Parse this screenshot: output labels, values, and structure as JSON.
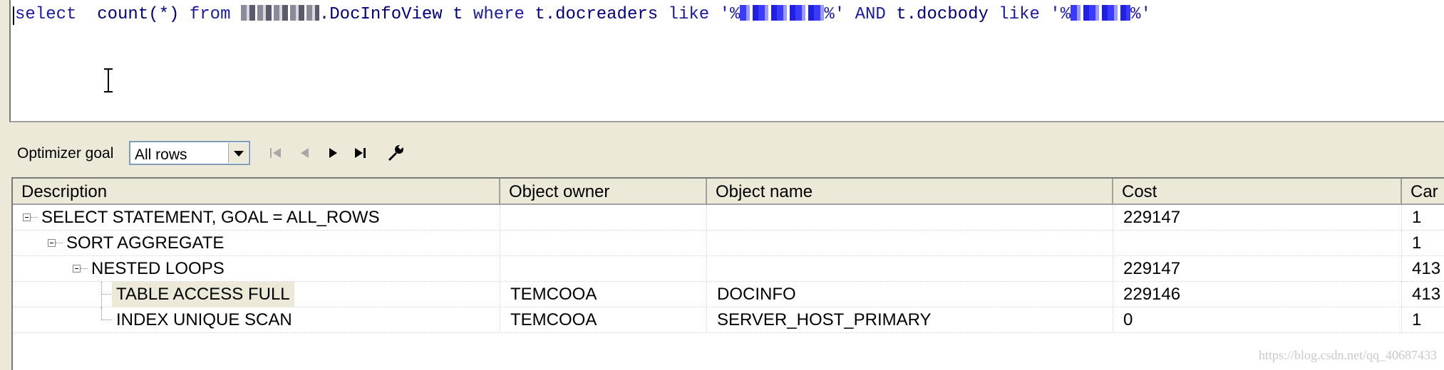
{
  "editor": {
    "tokens": [
      {
        "text": "select",
        "cls": "kw"
      },
      {
        "text": "  count(*) ",
        "cls": "id"
      },
      {
        "text": "from",
        "cls": "kw"
      },
      {
        "text": " ",
        "cls": "id"
      },
      {
        "redact": "grey",
        "w": 110
      },
      {
        "text": ".DocInfoView t ",
        "cls": "id"
      },
      {
        "text": "where",
        "cls": "kw"
      },
      {
        "text": " t.docreaders ",
        "cls": "id"
      },
      {
        "text": "like",
        "cls": "kw"
      },
      {
        "text": " '%",
        "cls": "str"
      },
      {
        "redact": "blue",
        "w": 118
      },
      {
        "text": "%' ",
        "cls": "str"
      },
      {
        "text": "AND",
        "cls": "kw"
      },
      {
        "text": " t.docbody ",
        "cls": "id"
      },
      {
        "text": "like",
        "cls": "kw"
      },
      {
        "text": " '%",
        "cls": "str"
      },
      {
        "redact": "blue",
        "w": 84
      },
      {
        "text": "%'",
        "cls": "str"
      }
    ]
  },
  "toolbar": {
    "goal_label": "Optimizer goal",
    "goal_value": "All rows",
    "nav_icons": [
      "first-record-icon",
      "previous-record-icon",
      "next-record-icon",
      "last-record-icon",
      "wrench-icon"
    ]
  },
  "grid": {
    "columns": [
      "Description",
      "Object owner",
      "Object name",
      "Cost",
      "Car"
    ],
    "rows": [
      {
        "depth": 0,
        "expander": true,
        "description": "SELECT STATEMENT, GOAL = ALL_ROWS",
        "owner": "",
        "object": "",
        "cost": "229147",
        "card": "1",
        "selected": false
      },
      {
        "depth": 1,
        "expander": true,
        "description": "SORT AGGREGATE",
        "owner": "",
        "object": "",
        "cost": "",
        "card": "1",
        "selected": false
      },
      {
        "depth": 2,
        "expander": true,
        "description": "NESTED LOOPS",
        "owner": "",
        "object": "",
        "cost": "229147",
        "card": "413",
        "selected": false
      },
      {
        "depth": 3,
        "expander": false,
        "description": "TABLE ACCESS FULL",
        "owner": "TEMCOOA",
        "object": "DOCINFO",
        "cost": "229146",
        "card": "413",
        "selected": true
      },
      {
        "depth": 3,
        "expander": false,
        "description": "INDEX UNIQUE SCAN",
        "owner": "TEMCOOA",
        "object": "SERVER_HOST_PRIMARY",
        "cost": "0",
        "card": "1",
        "selected": false
      }
    ]
  },
  "watermark": "https://blog.csdn.net/qq_40687433"
}
